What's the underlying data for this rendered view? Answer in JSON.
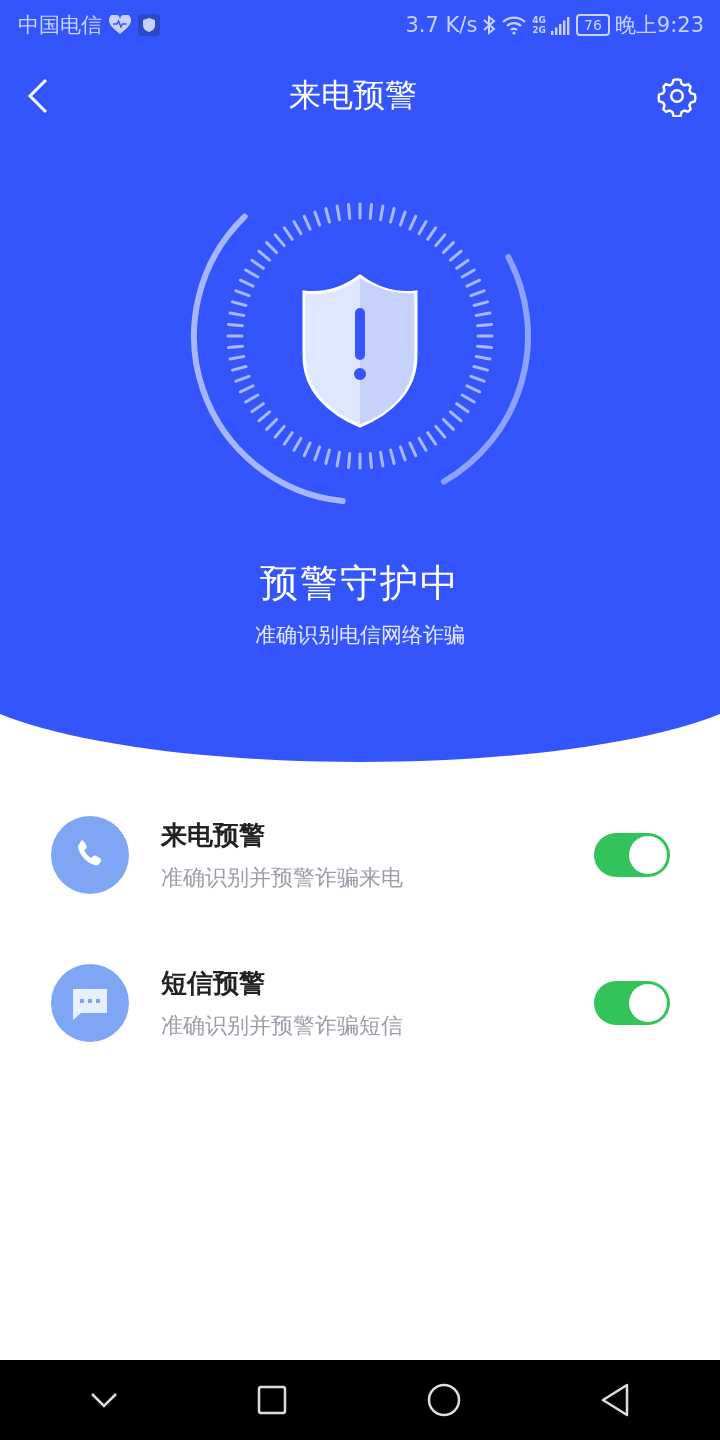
{
  "status_bar": {
    "carrier": "中国电信",
    "network_speed": "3.7 K/s",
    "network_types": [
      "4G",
      "2G"
    ],
    "battery": "76",
    "time": "晚上9:23"
  },
  "header": {
    "title": "来电预警"
  },
  "hero": {
    "title": "预警守护中",
    "subtitle": "准确识别电信网络诈骗"
  },
  "alerts": [
    {
      "kind": "call",
      "title": "来电预警",
      "subtitle": "准确识别并预警诈骗来电",
      "on": true
    },
    {
      "kind": "sms",
      "title": "短信预警",
      "subtitle": "准确识别并预警诈骗短信",
      "on": true
    }
  ]
}
